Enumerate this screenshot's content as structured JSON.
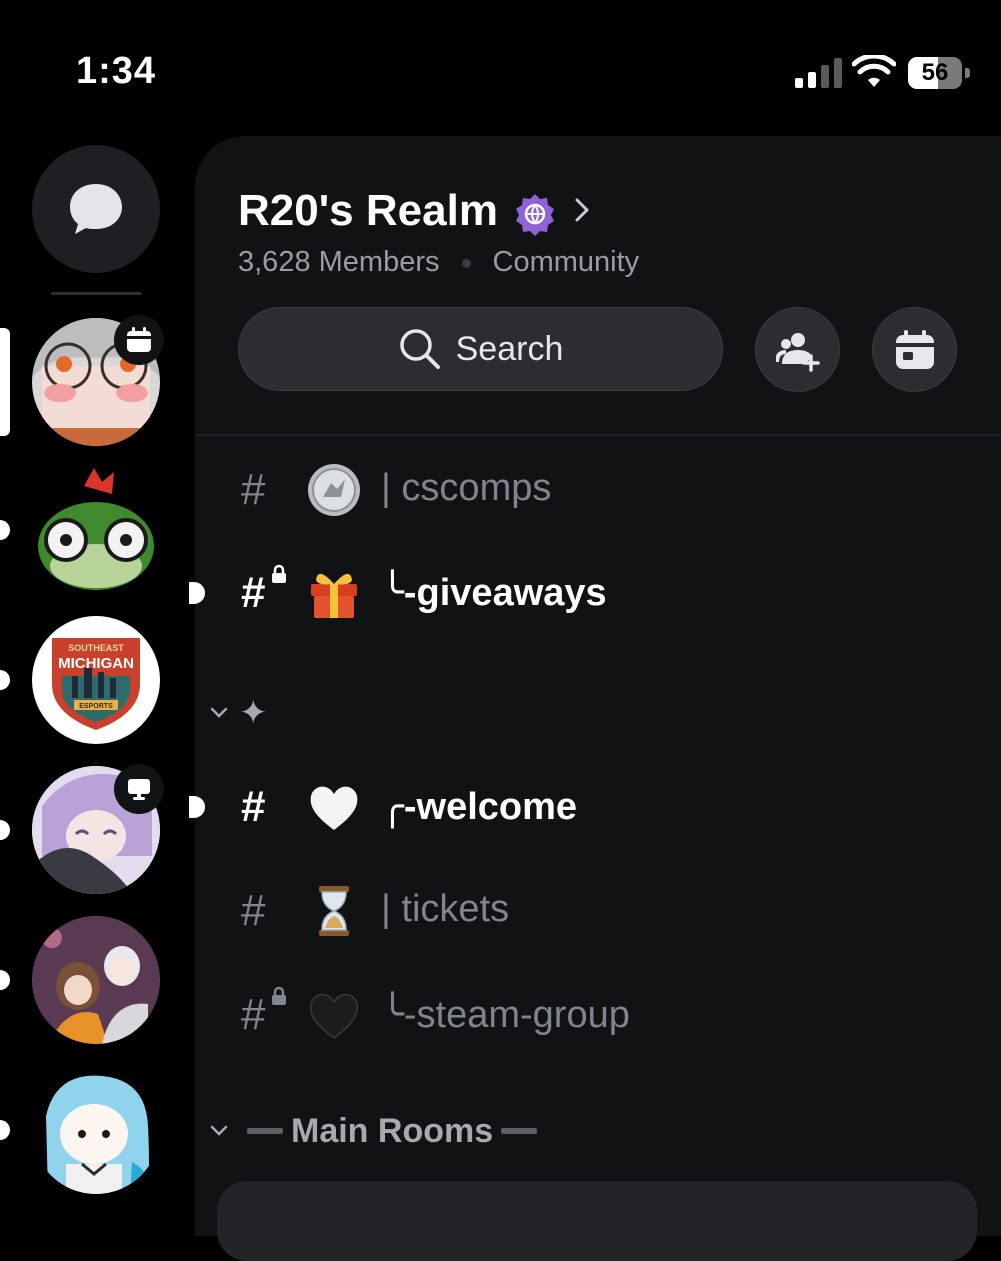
{
  "status_bar": {
    "time": "1:34",
    "battery": "56"
  },
  "server": {
    "name": "R20's Realm",
    "members": "3,628 Members",
    "type": "Community"
  },
  "search": {
    "label": "Search"
  },
  "channels": [
    {
      "name": "| cscomps",
      "emoji": "coin-emoji",
      "locked": false,
      "unread": false
    },
    {
      "name": "╰-giveaways",
      "emoji": "gift-emoji",
      "locked": true,
      "unread": true
    },
    {
      "name": "╭-welcome",
      "emoji": "white-heart-emoji",
      "locked": false,
      "unread": true
    },
    {
      "name": "| tickets",
      "emoji": "hourglass-emoji",
      "locked": false,
      "unread": false
    },
    {
      "name": "╰-steam-group",
      "emoji": "black-heart-emoji",
      "locked": true,
      "unread": false
    }
  ],
  "categories": [
    {
      "label": "✦"
    },
    {
      "label": "Main Rooms"
    }
  ],
  "server_list": [
    {
      "name": "server-anime-glasses",
      "badge": "calendar-icon"
    },
    {
      "name": "server-green-frog",
      "badge": ""
    },
    {
      "name": "server-southeast-michigan-esports",
      "logo_text": [
        "SOUTHEAST",
        "MICHIGAN",
        "ESPORTS"
      ]
    },
    {
      "name": "server-purple-hair",
      "badge": "monitor-icon"
    },
    {
      "name": "server-anime-duo",
      "badge": ""
    },
    {
      "name": "server-blue-chibi",
      "badge": ""
    }
  ],
  "colors": {
    "background": "#000000",
    "panel": "#111214",
    "button": "#2b2d31",
    "muted_text": "#80848e",
    "verified_badge": "#8f63d8"
  }
}
